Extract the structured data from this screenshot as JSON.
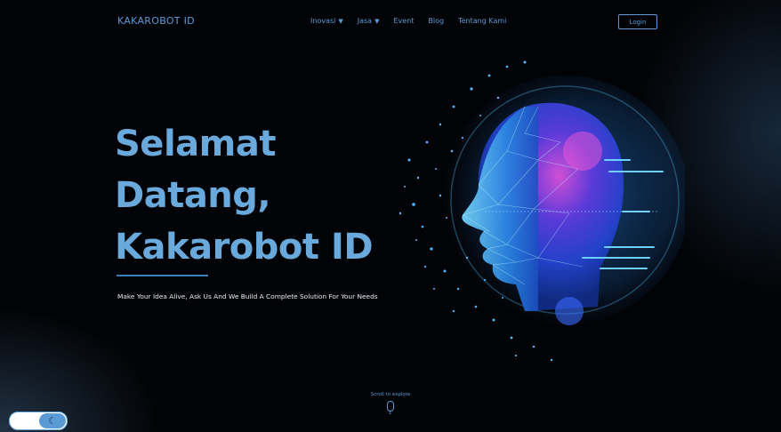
{
  "brand": {
    "name": "KAKAROBOT ID"
  },
  "nav": {
    "items": [
      {
        "label": "Inovasi",
        "dropdown": true,
        "icon": "caret-down-icon"
      },
      {
        "label": "Jasa",
        "dropdown": true,
        "icon": "caret-down-icon"
      },
      {
        "label": "Event",
        "dropdown": false
      },
      {
        "label": "Blog",
        "dropdown": false
      },
      {
        "label": "Tentang Kami",
        "dropdown": false
      }
    ],
    "login_label": "Login"
  },
  "hero": {
    "title_lines": [
      "Selamat",
      "Datang,",
      "Kakarobot ID"
    ],
    "subtitle": "Make Your Idea Alive, Ask Us And We Build A Complete Solution For Your Needs",
    "image": "ai-head-illustration"
  },
  "scroll": {
    "label": "Scroll to explore",
    "icon": "mouse-icon"
  },
  "theme_toggle": {
    "icon": "moon-icon",
    "mode": "dark"
  },
  "colors": {
    "accent": "#5b9bd5",
    "title": "#6aa9dc",
    "background": "#020306"
  }
}
